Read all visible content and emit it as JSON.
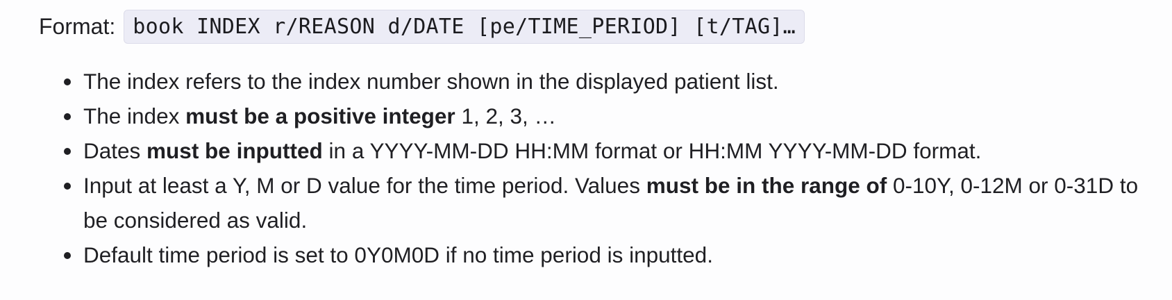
{
  "format": {
    "label": "Format:",
    "code": "book INDEX r/REASON d/DATE [pe/TIME_PERIOD] [t/TAG]…"
  },
  "points": [
    {
      "pre": "The index refers to the index number shown in the displayed patient list."
    },
    {
      "pre": "The index ",
      "bold": "must be a positive integer",
      "post": " 1, 2, 3, …"
    },
    {
      "pre": "Dates ",
      "bold": "must be inputted",
      "post": " in a YYYY-MM-DD HH:MM format or HH:MM YYYY-MM-DD format."
    },
    {
      "pre": "Input at least a Y, M or D value for the time period. Values ",
      "bold": "must be in the range of",
      "post": " 0-10Y, 0-12M or 0-31D to be considered as valid."
    },
    {
      "pre": "Default time period is set to 0Y0M0D if no time period is inputted."
    }
  ]
}
